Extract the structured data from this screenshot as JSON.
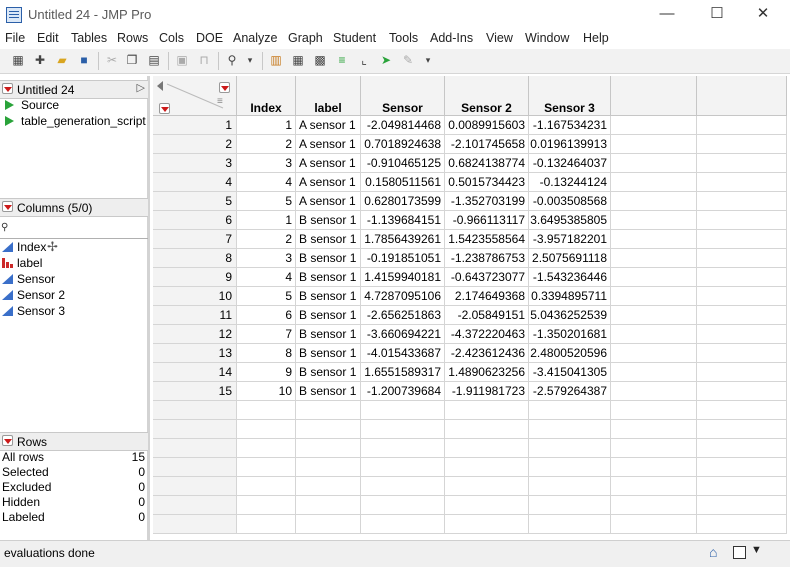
{
  "window": {
    "title": "Untitled 24 - JMP Pro",
    "minimize": "—",
    "maximize": "☐",
    "close": "✕"
  },
  "menu": [
    "File",
    "Edit",
    "Tables",
    "Rows",
    "Cols",
    "DOE",
    "Analyze",
    "Graph",
    "Student",
    "Tools",
    "Add-Ins",
    "View",
    "Window",
    "Help"
  ],
  "table_panel": {
    "title": "Untitled 24",
    "scripts": [
      "Source",
      "table_generation_script"
    ]
  },
  "columns_panel": {
    "title": "Columns (5/0)",
    "items": [
      {
        "name": "Index",
        "type": "continuous"
      },
      {
        "name": "label",
        "type": "nominal"
      },
      {
        "name": "Sensor",
        "type": "continuous"
      },
      {
        "name": "Sensor 2",
        "type": "continuous"
      },
      {
        "name": "Sensor 3",
        "type": "continuous"
      }
    ]
  },
  "rows_panel": {
    "title": "Rows",
    "items": [
      {
        "label": "All rows",
        "value": "15"
      },
      {
        "label": "Selected",
        "value": "0"
      },
      {
        "label": "Excluded",
        "value": "0"
      },
      {
        "label": "Hidden",
        "value": "0"
      },
      {
        "label": "Labeled",
        "value": "0"
      }
    ]
  },
  "grid": {
    "headers": [
      "Index",
      "label",
      "Sensor",
      "Sensor 2",
      "Sensor 3"
    ],
    "rows": [
      [
        "1",
        "1",
        "A sensor 1",
        "-2.049814468",
        "0.0089915603",
        "-1.167534231"
      ],
      [
        "2",
        "2",
        "A sensor 1",
        "0.7018924638",
        "-2.101745658",
        "0.0196139913"
      ],
      [
        "3",
        "3",
        "A sensor 1",
        "-0.910465125",
        "0.6824138774",
        "-0.132464037"
      ],
      [
        "4",
        "4",
        "A sensor 1",
        "0.1580511561",
        "0.5015734423",
        "-0.13244124"
      ],
      [
        "5",
        "5",
        "A sensor 1",
        "0.6280173599",
        "-1.352703199",
        "-0.003508568"
      ],
      [
        "6",
        "1",
        "B sensor 1",
        "-1.139684151",
        "-0.966113117",
        "3.6495385805"
      ],
      [
        "7",
        "2",
        "B sensor 1",
        "1.7856439261",
        "1.5423558564",
        "-3.957182201"
      ],
      [
        "8",
        "3",
        "B sensor 1",
        "-0.191851051",
        "-1.238786753",
        "2.5075691118"
      ],
      [
        "9",
        "4",
        "B sensor 1",
        "1.4159940181",
        "-0.643723077",
        "-1.543236446"
      ],
      [
        "10",
        "5",
        "B sensor 1",
        "4.7287095106",
        "2.174649368",
        "0.3394895711"
      ],
      [
        "11",
        "6",
        "B sensor 1",
        "-2.656251863",
        "-2.05849151",
        "5.0436252539"
      ],
      [
        "12",
        "7",
        "B sensor 1",
        "-3.660694221",
        "-4.372220463",
        "-1.350201681"
      ],
      [
        "13",
        "8",
        "B sensor 1",
        "-4.015433687",
        "-2.423612436",
        "2.4800520596"
      ],
      [
        "14",
        "9",
        "B sensor 1",
        "1.6551589317",
        "1.4890623256",
        "-3.415041305"
      ],
      [
        "15",
        "10",
        "B sensor 1",
        "-1.200739684",
        "-1.911981723",
        "-2.579264387"
      ]
    ]
  },
  "status": {
    "message": "evaluations done"
  },
  "colors": {
    "accent_red": "#cc1a1a",
    "script_green": "#2aa33a",
    "continuous_blue": "#3a6fc9"
  }
}
